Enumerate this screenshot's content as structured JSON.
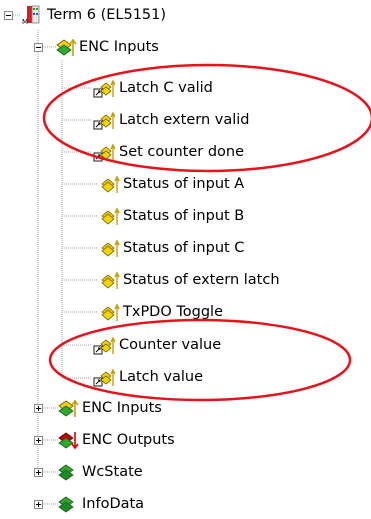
{
  "tree": {
    "root": {
      "label": "Term 6 (EL5151)",
      "icon": "terminal-module-icon"
    },
    "enc_inputs_expanded": {
      "label": "ENC Inputs",
      "icon": "input-variables-icon",
      "children": [
        {
          "label": "Latch C valid",
          "icon": "linked-input-variable-icon"
        },
        {
          "label": "Latch extern valid",
          "icon": "linked-input-variable-icon"
        },
        {
          "label": "Set counter done",
          "icon": "linked-input-variable-icon"
        },
        {
          "label": "Status of input A",
          "icon": "input-variable-icon"
        },
        {
          "label": "Status of input B",
          "icon": "input-variable-icon"
        },
        {
          "label": "Status of input C",
          "icon": "input-variable-icon"
        },
        {
          "label": "Status of extern latch",
          "icon": "input-variable-icon"
        },
        {
          "label": "TxPDO Toggle",
          "icon": "input-variable-icon"
        },
        {
          "label": "Counter value",
          "icon": "linked-input-variable-icon"
        },
        {
          "label": "Latch value",
          "icon": "linked-input-variable-icon"
        }
      ]
    },
    "collapsed_nodes": [
      {
        "label": "ENC Inputs",
        "icon": "input-variables-icon"
      },
      {
        "label": "ENC Outputs",
        "icon": "output-variables-icon"
      },
      {
        "label": "WcState",
        "icon": "wcstate-icon"
      },
      {
        "label": "InfoData",
        "icon": "infodata-icon"
      }
    ]
  },
  "colors": {
    "highlight_ellipse": "#e8121b",
    "tree_line": "#a0a0a0",
    "input_arrow": "#c8a000",
    "output_arrow": "#e00000",
    "variable_yellow": "#f2d200",
    "variable_green": "#2eaa2e",
    "variable_red": "#c80000"
  }
}
